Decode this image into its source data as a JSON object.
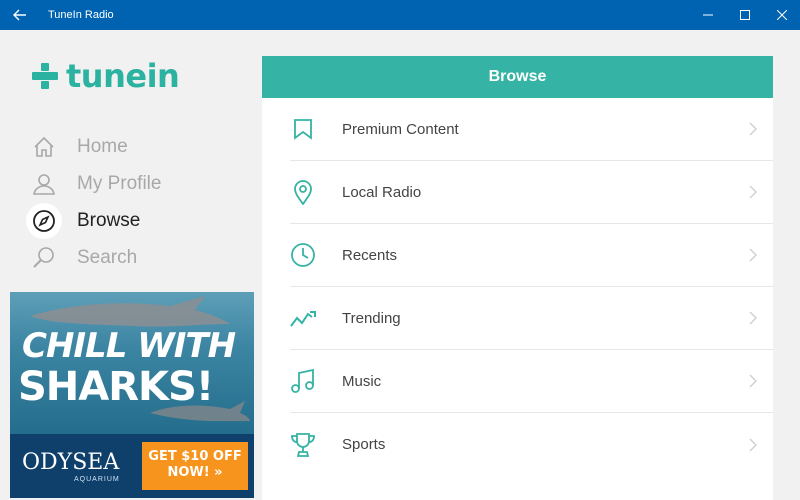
{
  "window": {
    "title": "TuneIn Radio"
  },
  "logo": {
    "text": "tunein"
  },
  "nav": {
    "items": [
      {
        "label": "Home",
        "icon": "home-icon"
      },
      {
        "label": "My Profile",
        "icon": "profile-icon"
      },
      {
        "label": "Browse",
        "icon": "compass-icon"
      },
      {
        "label": "Search",
        "icon": "search-icon"
      }
    ],
    "active": "Browse"
  },
  "ad": {
    "line1": "CHILL WITH",
    "line2": "SHARKS!",
    "brand": "ODYSEA",
    "brand_sub": "AQUARIUM",
    "offer_line1": "GET $10 OFF",
    "offer_line2": "NOW! »"
  },
  "main": {
    "title": "Browse",
    "rows": [
      {
        "label": "Premium Content",
        "icon": "bookmark-icon"
      },
      {
        "label": "Local Radio",
        "icon": "location-pin-icon"
      },
      {
        "label": "Recents",
        "icon": "clock-icon"
      },
      {
        "label": "Trending",
        "icon": "trending-icon"
      },
      {
        "label": "Music",
        "icon": "music-note-icon"
      },
      {
        "label": "Sports",
        "icon": "trophy-icon"
      }
    ]
  },
  "colors": {
    "accent": "#35b3a4",
    "titlebar": "#0063b1",
    "offer": "#f7941d"
  }
}
